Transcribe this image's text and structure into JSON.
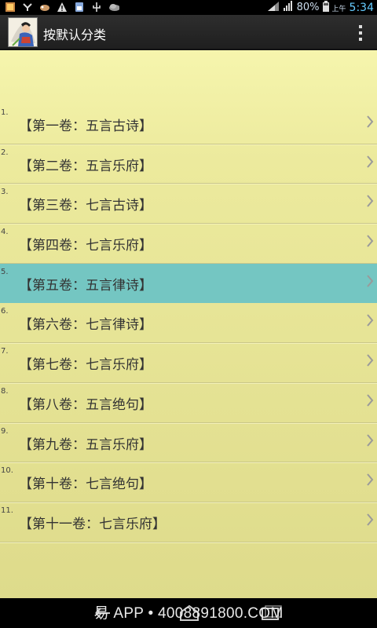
{
  "status_bar": {
    "battery_percent": "80%",
    "ampm": "上午",
    "time": "5:34",
    "icons": [
      "app-notification-icon",
      "usb-debug-icon",
      "game-icon",
      "warning-icon",
      "sim-card-icon",
      "usb-icon",
      "download-icon"
    ]
  },
  "action_bar": {
    "title": "按默认分类",
    "overflow_icon": "more-vert-icon"
  },
  "list": {
    "items": [
      {
        "num": "1.",
        "label": "【第一卷：五言古诗】"
      },
      {
        "num": "2.",
        "label": "【第二卷：五言乐府】"
      },
      {
        "num": "3.",
        "label": "【第三卷：七言古诗】"
      },
      {
        "num": "4.",
        "label": "【第四卷：七言乐府】"
      },
      {
        "num": "5.",
        "label": "【第五卷：五言律诗】"
      },
      {
        "num": "6.",
        "label": "【第六卷：七言律诗】"
      },
      {
        "num": "7.",
        "label": "【第七卷：七言乐府】"
      },
      {
        "num": "8.",
        "label": "【第八卷：五言绝句】"
      },
      {
        "num": "9.",
        "label": "【第九卷：五言乐府】"
      },
      {
        "num": "10.",
        "label": "【第十卷：七言绝句】"
      },
      {
        "num": "11.",
        "label": "【第十一卷：七言乐府】"
      }
    ],
    "selected_index": 4
  },
  "watermark": "易 APP • 4008891800.COM",
  "colors": {
    "selected_row": "#74c6c2",
    "content_bg": "#e8e69a",
    "status_time": "#66ccff"
  }
}
